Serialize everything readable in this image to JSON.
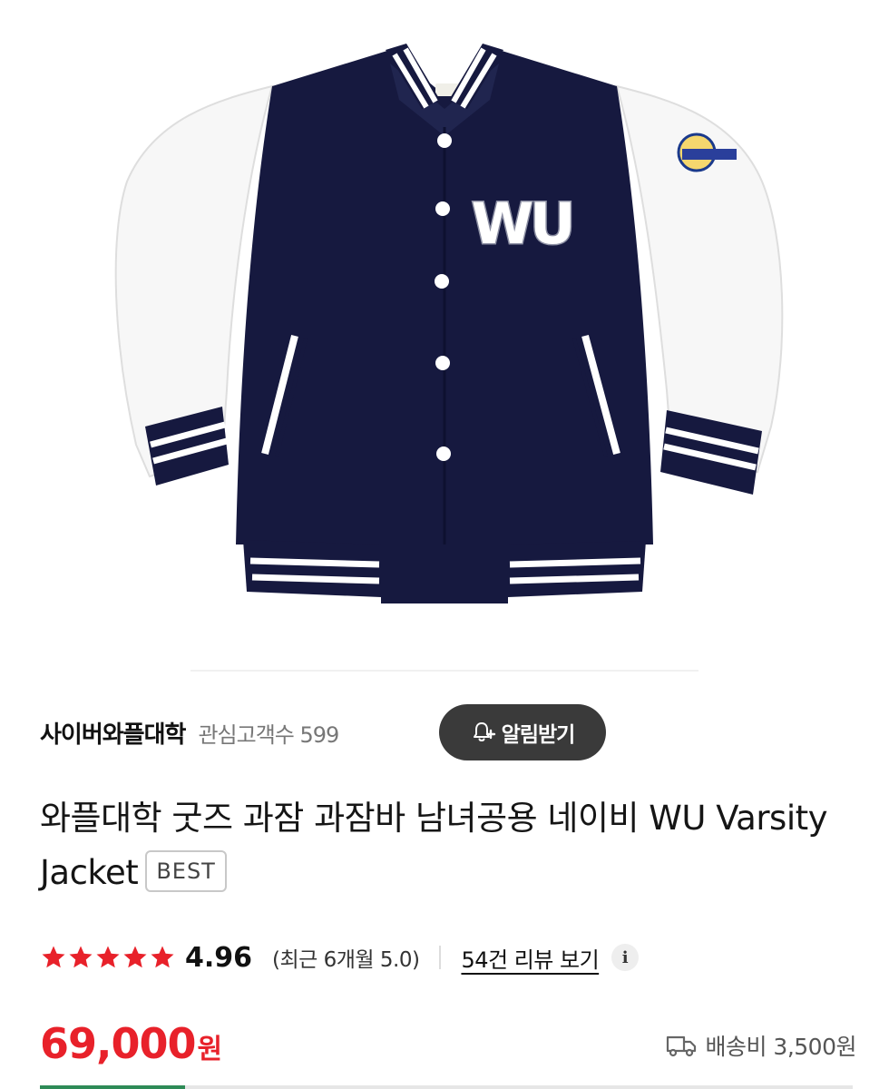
{
  "seller": {
    "name": "사이버와플대학",
    "fans_label": "관심고객수 599",
    "notify_label": "알림받기"
  },
  "product": {
    "title": "와플대학 굿즈 과잠 과잠바 남녀공용 네이비 WU Varsity Jacket",
    "badge": "BEST",
    "jacket_letters": "WU"
  },
  "rating": {
    "stars": 5,
    "score": "4.96",
    "recent": "(최근 6개월 5.0)",
    "review_link": "54건 리뷰 보기",
    "info_icon": "info-icon"
  },
  "price": {
    "amount": "69,000",
    "unit": "원"
  },
  "shipping": {
    "label": "배송비 3,500원",
    "icon": "truck-icon"
  },
  "colors": {
    "accent": "#e8212a",
    "navy": "#16193f",
    "button_bg": "#3a3a3a",
    "star": "#e8212a"
  }
}
